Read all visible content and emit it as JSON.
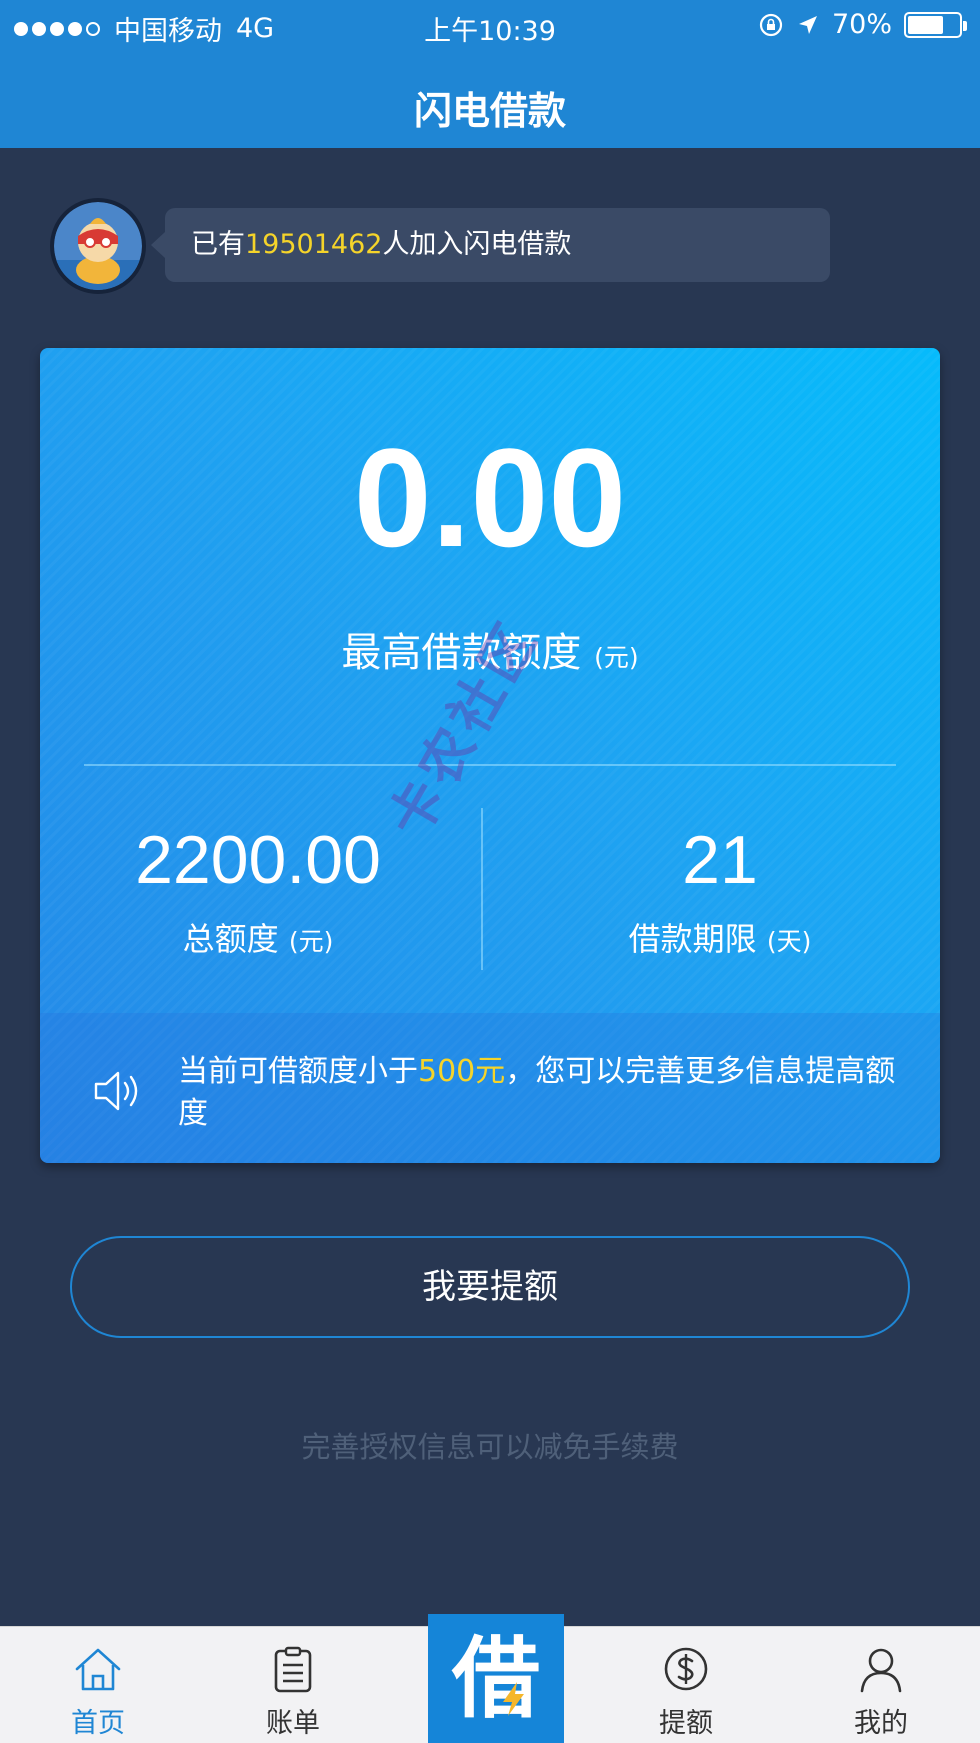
{
  "status_bar": {
    "carrier": "中国移动",
    "network": "4G",
    "time": "上午10:39",
    "battery": "70%",
    "battery_level": 0.7
  },
  "nav": {
    "title": "闪电借款"
  },
  "users_notice": {
    "prefix": "已有",
    "count": "19501462",
    "suffix": "人加入闪电借款"
  },
  "credit_card": {
    "max_amount": "0.00",
    "max_amount_label": "最高借款额度",
    "max_amount_unit": "(元)",
    "total_amount": "2200.00",
    "total_label": "总额度",
    "total_unit": "(元)",
    "term": "21",
    "term_label": "借款期限",
    "term_unit": "(天)",
    "notice_prefix": "当前可借额度小于",
    "notice_highlight": "500元",
    "notice_suffix": "，您可以完善更多信息提高额度"
  },
  "raise_button": {
    "label": "我要提额"
  },
  "hint": "完善授权信息可以减免手续费",
  "watermark": "卡农社区",
  "tabbar": {
    "items": [
      {
        "label": "首页",
        "icon": "home-icon"
      },
      {
        "label": "账单",
        "icon": "bill-icon"
      },
      {
        "label": "借",
        "icon": "lightning-icon"
      },
      {
        "label": "提额",
        "icon": "dollar-icon"
      },
      {
        "label": "我的",
        "icon": "user-icon"
      }
    ]
  },
  "colors": {
    "background": "#283752",
    "nav_blue": "#1f86d4",
    "highlight_yellow": "#f5d42a",
    "card_gradient_start": "#06bbfb",
    "card_gradient_end": "#2588e7"
  }
}
